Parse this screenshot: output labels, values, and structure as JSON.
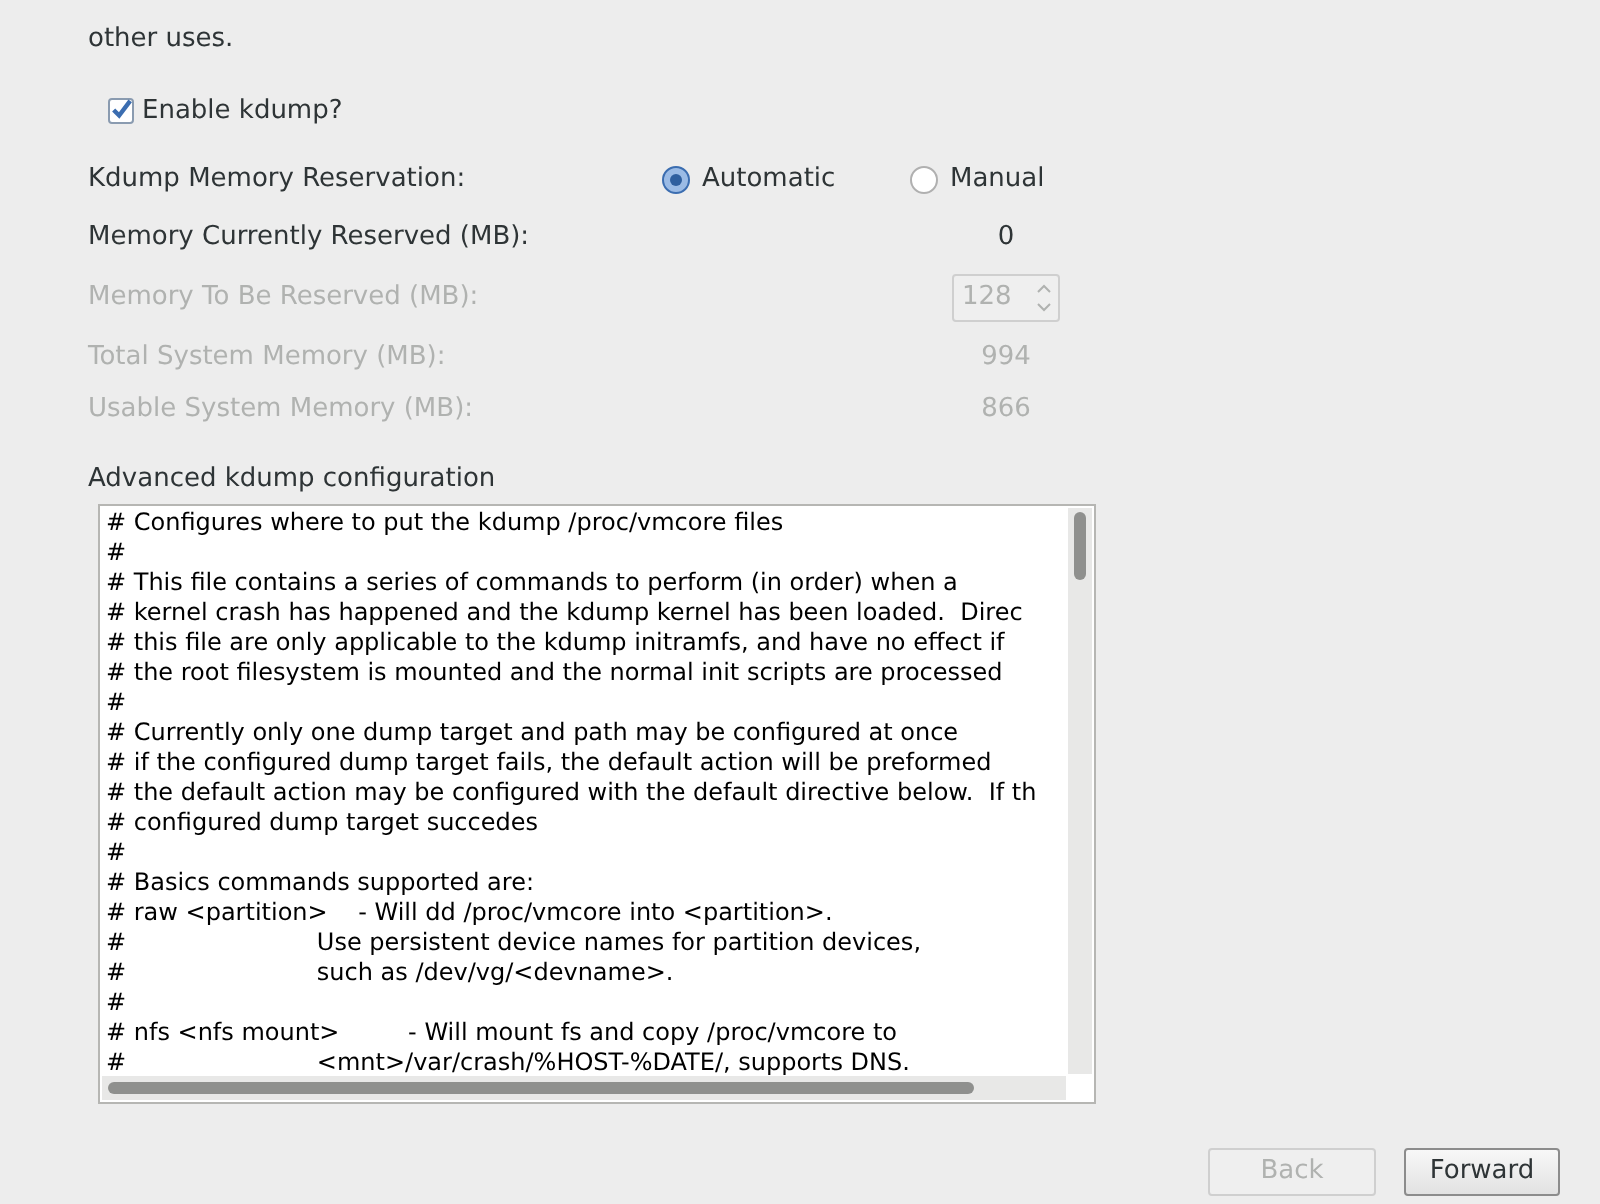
{
  "intro": "other uses.",
  "enable": {
    "label": "Enable kdump?",
    "checked": true
  },
  "reservation": {
    "label": "Kdump Memory Reservation:",
    "options": [
      {
        "label": "Automatic",
        "selected": true
      },
      {
        "label": "Manual",
        "selected": false
      }
    ]
  },
  "rows": [
    {
      "kind": "value",
      "label": "Memory Currently Reserved (MB):",
      "value": "0",
      "disabled": false
    },
    {
      "kind": "spin",
      "label": "Memory To Be Reserved (MB):",
      "value": "128",
      "disabled": true
    },
    {
      "kind": "value",
      "label": "Total System Memory (MB):",
      "value": "994",
      "disabled": true
    },
    {
      "kind": "value",
      "label": "Usable System Memory (MB):",
      "value": "866",
      "disabled": true
    }
  ],
  "advanced": {
    "label": "Advanced kdump configuration",
    "lines": [
      "# Configures where to put the kdump /proc/vmcore files",
      "#",
      "# This file contains a series of commands to perform (in order) when a",
      "# kernel crash has happened and the kdump kernel has been loaded.  Direc",
      "# this file are only applicable to the kdump initramfs, and have no effect if",
      "# the root filesystem is mounted and the normal init scripts are processed",
      "#",
      "# Currently only one dump target and path may be configured at once",
      "# if the configured dump target fails, the default action will be preformed",
      "# the default action may be configured with the default directive below.  If th",
      "# configured dump target succedes",
      "#",
      "# Basics commands supported are:",
      "# raw <partition>    - Will dd /proc/vmcore into <partition>.",
      "#                         Use persistent device names for partition devices,",
      "#                         such as /dev/vg/<devname>.",
      "#",
      "# nfs <nfs mount>         - Will mount fs and copy /proc/vmcore to",
      "#                         <mnt>/var/crash/%HOST-%DATE/, supports DNS."
    ]
  },
  "buttons": [
    {
      "label": "Back",
      "disabled": true
    },
    {
      "label": "Forward",
      "disabled": false
    }
  ]
}
